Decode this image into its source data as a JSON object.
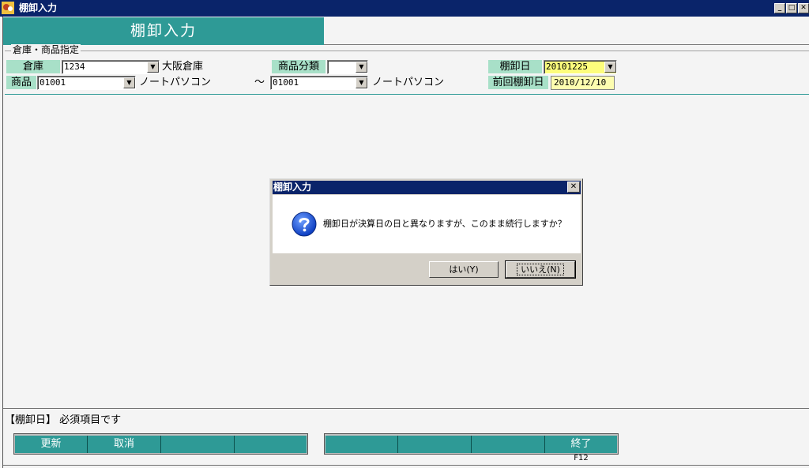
{
  "window": {
    "title": "棚卸入力"
  },
  "header": {
    "title": "棚卸入力"
  },
  "group": {
    "label": "倉庫・商品指定"
  },
  "warehouse": {
    "label": "倉庫",
    "code": "1234",
    "name": "大阪倉庫"
  },
  "category": {
    "label": "商品分類",
    "value": ""
  },
  "inventory_date": {
    "label": "棚卸日",
    "value": "20101225"
  },
  "product": {
    "label": "商品",
    "from_code": "01001",
    "from_name": "ノートパソコン",
    "tilde": "～",
    "to_code": "01001",
    "to_name": "ノートパソコン"
  },
  "previous_date": {
    "label": "前回棚卸日",
    "value": "2010/12/10"
  },
  "dialog": {
    "title": "棚卸入力",
    "message": "棚卸日が決算日の日と異なりますが、このまま続行しますか？",
    "yes_label": "はい(Y)",
    "no_label": "いいえ(N)",
    "close_label": "✕",
    "icon": "question-icon"
  },
  "status": {
    "message": "【棚卸日】 必須項目です"
  },
  "function_keys": {
    "f1": "更新",
    "f2": "取消",
    "f3": "",
    "f4": "",
    "f5": "",
    "f6": "",
    "f7": "",
    "f8": "",
    "f12": "終了",
    "f12_key": "F12"
  },
  "colors": {
    "accent": "#2e9a96",
    "titlebar": "#0a246a",
    "label_bg": "#a8e0c8",
    "input_highlight": "#fdfd7c"
  }
}
